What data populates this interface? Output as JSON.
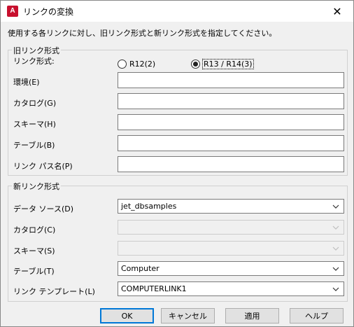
{
  "window": {
    "app_icon_letter": "A",
    "title": "リンクの変換",
    "close_glyph": "✕"
  },
  "instruction": "使用する各リンクに対し、旧リンク形式と新リンク形式を指定してください。",
  "old_group": {
    "legend": "旧リンク形式",
    "format_label": "リンク形式:",
    "radio_r12": "R12(2)",
    "radio_r13": "R13 / R14(3)",
    "selected": "R13 / R14(3)",
    "env_label": "環境(E)",
    "catalog_label": "カタログ(G)",
    "schema_label": "スキーマ(H)",
    "table_label": "テーブル(B)",
    "linkpath_label": "リンク パス名(P)",
    "env_value": "",
    "catalog_value": "",
    "schema_value": "",
    "table_value": "",
    "linkpath_value": ""
  },
  "new_group": {
    "legend": "新リンク形式",
    "datasource_label": "データ ソース(D)",
    "datasource_value": "jet_dbsamples",
    "catalog_label": "カタログ(C)",
    "catalog_value": "",
    "schema_label": "スキーマ(S)",
    "schema_value": "",
    "table_label": "テーブル(T)",
    "table_value": "Computer",
    "template_label": "リンク テンプレート(L)",
    "template_value": "COMPUTERLINK1"
  },
  "buttons": {
    "ok": "OK",
    "cancel": "キャンセル",
    "apply": "適用",
    "help": "ヘルプ"
  },
  "colors": {
    "app_icon": "#c8102e",
    "default_button_border": "#0078d7"
  }
}
